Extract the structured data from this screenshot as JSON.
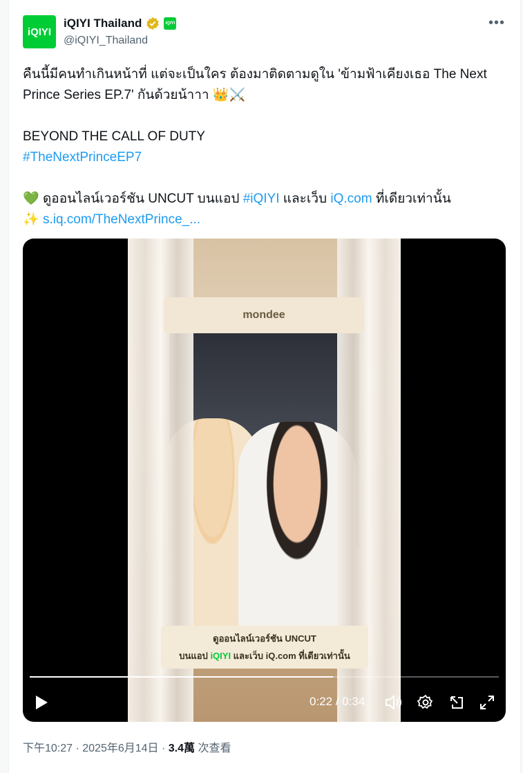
{
  "tweet": {
    "author_name": "iQIYI Thailand",
    "author_handle": "@iQIYI_Thailand",
    "avatar_text": "iQIYI",
    "affiliate_badge_text": "iQIYI",
    "more_label": "•••",
    "line1": "คืนนี้มีคนทำเกินหน้าที่ แต่จะเป็นใคร ต้องมาติดตามดูใน 'ข้ามฟ้าเคียงเธอ The Next Prince Series EP.7' กันด้วยน้าาา",
    "line1_emoji": "👑⚔️",
    "line2": "BEYOND THE CALL OF DUTY",
    "hashtag1": "#TheNextPrinceEP7",
    "line3_emoji": "💚",
    "line3_prefix": " ดูออนไลน์เวอร์ชัน UNCUT บนแอป ",
    "hashtag2": "#iQIYI",
    "line3_mid": " และเว็บ ",
    "link1": "iQ.com",
    "line3_suffix": " ที่เดียวเท่านั้น",
    "line4_emoji": "✨",
    "link2": "s.iq.com/TheNextPrince_..."
  },
  "video": {
    "watermark": "mondee",
    "caption_line1": "ดูออนไลน์เวอร์ชัน UNCUT",
    "caption_line2_prefix": "บนแอป ",
    "caption_brand": "iQIYI",
    "caption_line2_suffix": " และเว็บ iQ.com ที่เดียวเท่านั้น",
    "time_display": "0:22 / 0:34",
    "progress": 0.647
  },
  "meta": {
    "timestamp": "下午10:27 · 2025年6月14日 · ",
    "views_count": "3.4萬",
    "views_label": " 次查看"
  },
  "colors": {
    "link": "#1d9bf0",
    "brand": "#00cc36"
  }
}
